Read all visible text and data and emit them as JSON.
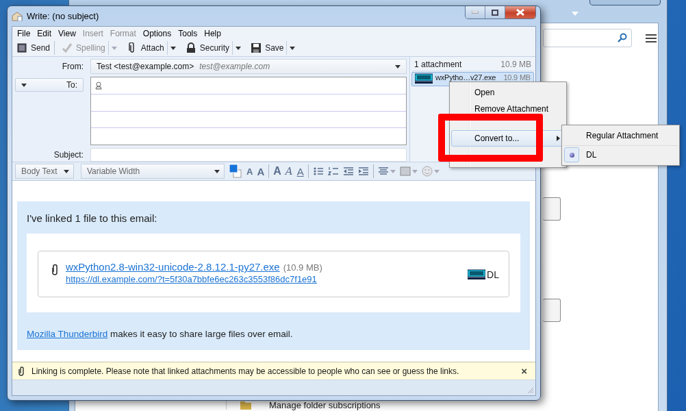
{
  "background_window": {
    "folder_action": "Manage folder subscriptions"
  },
  "window": {
    "title": "Write: (no subject)"
  },
  "menu_bar": [
    {
      "label": "File",
      "disabled": false
    },
    {
      "label": "Edit",
      "disabled": false
    },
    {
      "label": "View",
      "disabled": false
    },
    {
      "label": "Insert",
      "disabled": true
    },
    {
      "label": "Format",
      "disabled": true
    },
    {
      "label": "Options",
      "disabled": false
    },
    {
      "label": "Tools",
      "disabled": false
    },
    {
      "label": "Help",
      "disabled": false
    }
  ],
  "toolbar": [
    {
      "label": "Send",
      "kind": "send",
      "disabled": false,
      "dropdown": false
    },
    {
      "label": "Spelling",
      "kind": "spelling",
      "disabled": true,
      "dropdown": true
    },
    {
      "label": "Attach",
      "kind": "attach",
      "disabled": false,
      "dropdown": true
    },
    {
      "label": "Security",
      "kind": "security",
      "disabled": false,
      "dropdown": true
    },
    {
      "label": "Save",
      "kind": "save",
      "disabled": false,
      "dropdown": true
    }
  ],
  "from": {
    "label": "From:",
    "value": "Test <test@example.com>",
    "identity": "test@example.com"
  },
  "to": {
    "label": "To:"
  },
  "subject": {
    "label": "Subject:"
  },
  "attachments": {
    "summary": "1 attachment",
    "total_size": "10.9 MB",
    "items": [
      {
        "name": "wxPytho…v27.exe",
        "size": "10.9 MB",
        "selected": true
      }
    ]
  },
  "format_bar": {
    "paragraph_style": "Body Text",
    "font": "Variable Width",
    "buttons": [
      {
        "kind": "smaller",
        "glyph": "A"
      },
      {
        "kind": "larger",
        "glyph": "A"
      },
      {
        "kind": "bold",
        "glyph": "A"
      },
      {
        "kind": "italic",
        "glyph": "A"
      },
      {
        "kind": "underline",
        "glyph": "A"
      },
      {
        "kind": "bullets"
      },
      {
        "kind": "numbers"
      },
      {
        "kind": "outdent"
      },
      {
        "kind": "indent"
      },
      {
        "kind": "align"
      },
      {
        "kind": "insert"
      },
      {
        "kind": "smiley"
      }
    ]
  },
  "body": {
    "intro": "I've linked 1 file to this email:",
    "file": {
      "name": "wxPython2.8-win32-unicode-2.8.12.1-py27.exe",
      "size": "(10.9 MB)",
      "url": "https://dl.example.com/?t=5f30a7bbfe6ec263c3553f86dc7f1e91",
      "provider": "DL"
    },
    "footer_link": "Mozilla Thunderbird",
    "footer_text": " makes it easy to share large files over email."
  },
  "notification": {
    "text": "Linking is complete. Please note that linked attachments may be accessible to people who can see or guess the links.",
    "dismiss": "×"
  },
  "context_menu": {
    "items": [
      {
        "label": "Open",
        "selected": false,
        "submenu": false
      },
      {
        "label": "Remove Attachment",
        "selected": false,
        "submenu": false
      },
      {
        "label": "Convert to...",
        "selected": true,
        "submenu": true
      }
    ]
  },
  "submenu": {
    "items": [
      {
        "label": "Regular Attachment",
        "selected": false
      },
      {
        "label": "DL",
        "selected": true
      }
    ]
  }
}
